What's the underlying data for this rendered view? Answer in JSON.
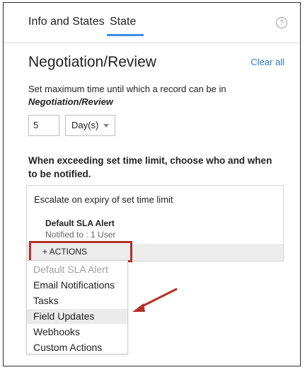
{
  "tabs": [
    {
      "label": "Info and States"
    },
    {
      "label": "State",
      "active": true
    }
  ],
  "help_icon": {
    "glyph": "?",
    "icon": "help-circle-icon"
  },
  "stage": {
    "title": "Negotiation/Review",
    "clear_all": "Clear all"
  },
  "time_limit": {
    "description": "Set maximum time until which a record can be in",
    "stage_name": "Negotiation/Review",
    "value": "5",
    "unit": "Day(s)"
  },
  "notify": {
    "heading": "When exceeding set time limit, choose who and when to be notified."
  },
  "escalate": {
    "title": "Escalate on expiry of set time limit",
    "alert_name": "Default SLA Alert",
    "alert_sub": "Notified to : 1 User",
    "actions_label": "+ ACTIONS"
  },
  "actions_menu": {
    "items": [
      {
        "label": "Default SLA Alert",
        "disabled": true
      },
      {
        "label": "Email Notifications"
      },
      {
        "label": "Tasks"
      },
      {
        "label": "Field Updates",
        "highlighted": true
      },
      {
        "label": "Webhooks"
      },
      {
        "label": "Custom Actions"
      }
    ]
  },
  "colors": {
    "accent_blue": "#3a8ee6",
    "link_blue": "#2a7bd4",
    "annotation_red": "#b3302b"
  }
}
